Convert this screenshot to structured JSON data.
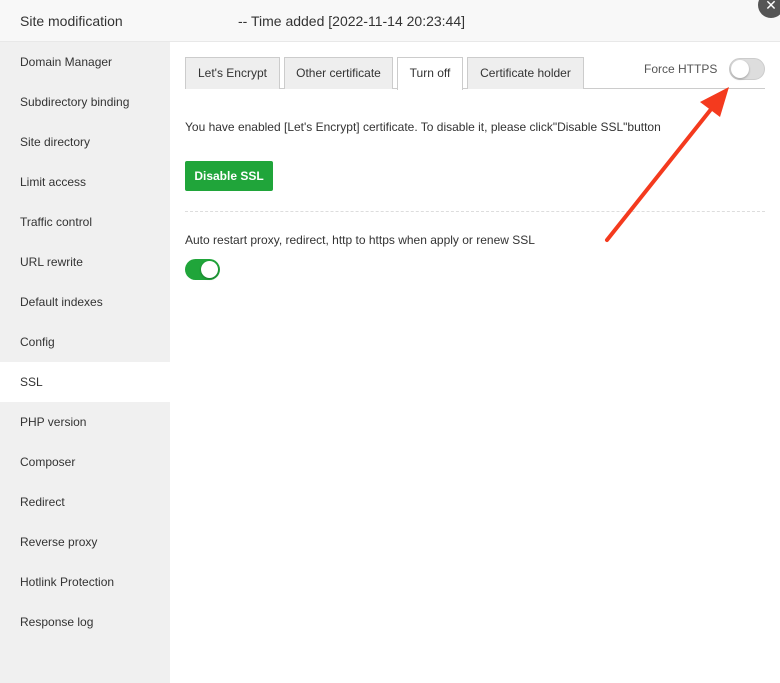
{
  "header": {
    "title": "Site modification",
    "subtitle": "-- Time added [2022-11-14 20:23:44]"
  },
  "sidebar": {
    "items": [
      {
        "label": "Domain Manager"
      },
      {
        "label": "Subdirectory binding"
      },
      {
        "label": "Site directory"
      },
      {
        "label": "Limit access"
      },
      {
        "label": "Traffic control"
      },
      {
        "label": "URL rewrite"
      },
      {
        "label": "Default indexes"
      },
      {
        "label": "Config"
      },
      {
        "label": "SSL",
        "active": true
      },
      {
        "label": "PHP version"
      },
      {
        "label": "Composer"
      },
      {
        "label": "Redirect"
      },
      {
        "label": "Reverse proxy"
      },
      {
        "label": "Hotlink Protection"
      },
      {
        "label": "Response log"
      }
    ]
  },
  "tabs": [
    {
      "label": "Let's Encrypt"
    },
    {
      "label": "Other certificate"
    },
    {
      "label": "Turn off",
      "active": true
    },
    {
      "label": "Certificate holder"
    }
  ],
  "force_https": {
    "label": "Force HTTPS",
    "enabled": false
  },
  "main": {
    "message": "You have enabled [Let's Encrypt] certificate. To disable it, please click\"Disable SSL\"button",
    "disable_button": "Disable SSL",
    "auto_restart_label": "Auto restart proxy, redirect, http to https when apply or renew SSL",
    "auto_restart_enabled": true
  },
  "colors": {
    "accent": "#20a53a",
    "arrow": "#f43a1e"
  }
}
